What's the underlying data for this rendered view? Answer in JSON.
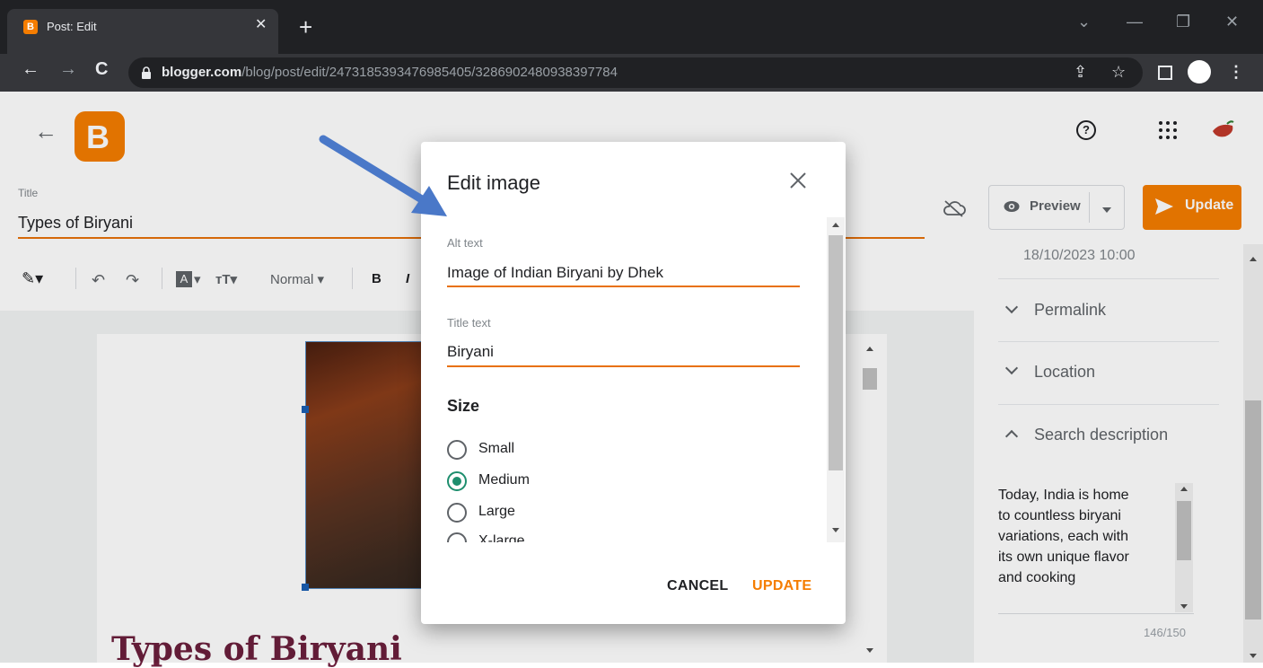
{
  "browser": {
    "tab_title": "Post: Edit",
    "tab_favicon_letter": "B",
    "url_domain": "blogger.com",
    "url_path": "/blog/post/edit/2473185393476985405/3286902480938397784"
  },
  "app": {
    "title_label": "Title",
    "title_value": "Types of Biryani",
    "preview_label": "Preview",
    "update_label": "Update",
    "format_style": "Normal",
    "help_glyph": "?",
    "logo_letter": "B"
  },
  "sidebar": {
    "date_text": "18/10/2023 10:00",
    "items": [
      {
        "label": "Permalink"
      },
      {
        "label": "Location"
      },
      {
        "label": "Search description"
      }
    ],
    "description_lines": [
      "Today, India is home",
      "to countless biryani",
      "variations, each with",
      "its own unique flavor",
      "and cooking"
    ],
    "char_count": "146/150"
  },
  "post": {
    "heading": "Types of Biryani"
  },
  "dialog": {
    "title": "Edit image",
    "alt_label": "Alt text",
    "alt_value": "Image of Indian Biryani by Dhek",
    "title_text_label": "Title text",
    "title_text_value": "Biryani",
    "size_heading": "Size",
    "size_options": [
      {
        "label": "Small",
        "selected": false
      },
      {
        "label": "Medium",
        "selected": true
      },
      {
        "label": "Large",
        "selected": false
      },
      {
        "label": "X-large",
        "selected": false
      }
    ],
    "cancel_label": "CANCEL",
    "update_label": "UPDATE"
  },
  "colors": {
    "brand_orange": "#f57d00",
    "radio_accent": "#1e8e6e",
    "annotation_arrow": "#4a78c8",
    "heading_color": "#6b1f3c"
  }
}
